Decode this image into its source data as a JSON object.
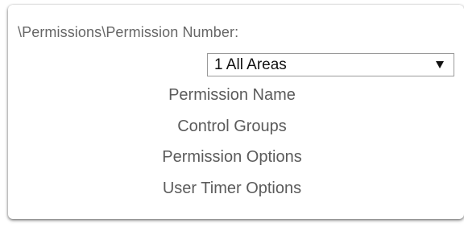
{
  "path_label": "\\Permissions\\Permission Number:",
  "permission_select": {
    "selected_value": "1 All Areas"
  },
  "menu": [
    {
      "label": "Permission Name"
    },
    {
      "label": "Control Groups"
    },
    {
      "label": "Permission Options"
    },
    {
      "label": "User Timer Options"
    }
  ]
}
